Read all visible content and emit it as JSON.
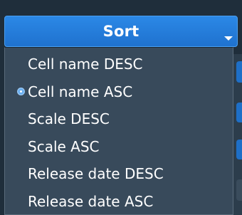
{
  "sort_button": {
    "label": "Sort"
  },
  "menu": {
    "items": [
      {
        "label": "Cell name DESC",
        "selected": false
      },
      {
        "label": "Cell name ASC",
        "selected": true
      },
      {
        "label": "Scale DESC",
        "selected": false
      },
      {
        "label": "Scale ASC",
        "selected": false
      },
      {
        "label": "Release date DESC",
        "selected": false
      },
      {
        "label": "Release date ASC",
        "selected": false
      }
    ]
  },
  "colors": {
    "accent": "#2283e0",
    "menu_background": "#384a5b",
    "page_background": "#1f2e3b",
    "selected_dot": "#6aaff0"
  },
  "icons": {
    "dropdown_caret": "caret-down-icon",
    "selection_marker": "radio-dot-icon"
  }
}
